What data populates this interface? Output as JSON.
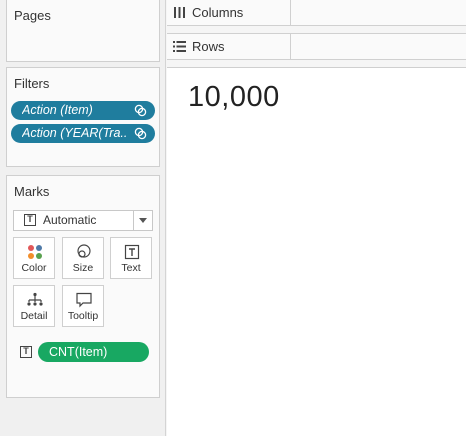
{
  "pages": {
    "title": "Pages"
  },
  "filters": {
    "title": "Filters",
    "items": [
      {
        "label": "Action (Item)"
      },
      {
        "label": "Action (YEAR(Tra.."
      }
    ]
  },
  "marks": {
    "title": "Marks",
    "mark_type": "Automatic",
    "buttons": [
      {
        "label": "Color"
      },
      {
        "label": "Size"
      },
      {
        "label": "Text"
      },
      {
        "label": "Detail"
      },
      {
        "label": "Tooltip"
      }
    ],
    "fields": [
      {
        "label": "CNT(Item)"
      }
    ]
  },
  "shelves": {
    "columns": "Columns",
    "rows": "Rows"
  },
  "view": {
    "value": "10,000"
  },
  "colors": {
    "filter_pill": "#1f7d9e",
    "measure_pill": "#18a862"
  }
}
